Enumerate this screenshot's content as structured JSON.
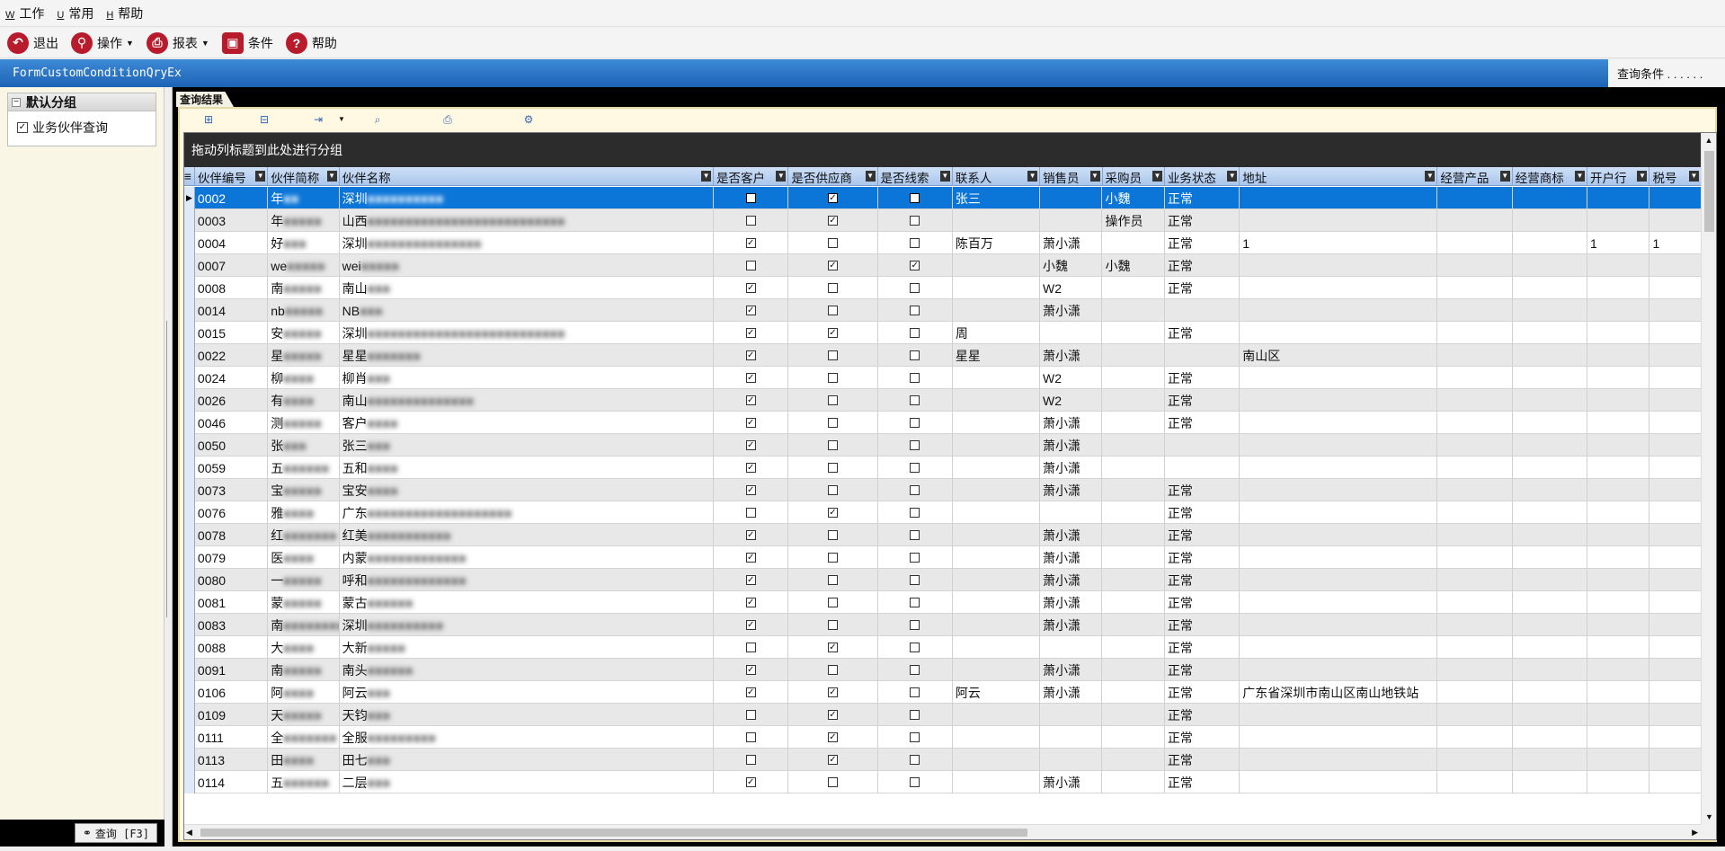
{
  "menu": [
    {
      "key": "W",
      "label": "工作"
    },
    {
      "key": "U",
      "label": "常用"
    },
    {
      "key": "H",
      "label": "帮助"
    }
  ],
  "toolbar": {
    "exit": "退出",
    "operate": "操作",
    "report": "报表",
    "condition": "条件",
    "help": "帮助"
  },
  "form": {
    "title": "FormCustomConditionQryEx",
    "right_label": "查询条件 . . . . . ."
  },
  "left": {
    "group_title": "默认分组",
    "item_label": "业务伙伴查询",
    "item_checked": true,
    "query_button": "查询 [F3]"
  },
  "tab": {
    "label": "查询结果"
  },
  "grid": {
    "group_hint": "拖动列标题到此处进行分组",
    "columns": [
      "伙伴编号",
      "伙伴简称",
      "伙伴名称",
      "是否客户",
      "是否供应商",
      "是否线索",
      "联系人",
      "销售员",
      "采购员",
      "业务状态",
      "地址",
      "经营产品",
      "经营商标",
      "开户行",
      "税号"
    ],
    "rows": [
      {
        "code": "0002",
        "short": "年**",
        "name": "深圳**********",
        "cust": false,
        "supp": true,
        "lead": false,
        "contact": "张三",
        "sales": "",
        "buyer": "小魏",
        "status": "正常",
        "addr": "",
        "bank": "",
        "tax": ""
      },
      {
        "code": "0003",
        "short": "年*****",
        "name": "山西**************************",
        "cust": false,
        "supp": true,
        "lead": false,
        "contact": "",
        "sales": "",
        "buyer": "操作员",
        "status": "正常",
        "addr": "",
        "bank": "",
        "tax": ""
      },
      {
        "code": "0004",
        "short": "好***",
        "name": "深圳***************",
        "cust": true,
        "supp": false,
        "lead": false,
        "contact": "陈百万",
        "sales": "萧小潇",
        "buyer": "",
        "status": "正常",
        "addr": "1",
        "bank": "1",
        "tax": "1"
      },
      {
        "code": "0007",
        "short": "we*****",
        "name": "wei*****",
        "cust": false,
        "supp": true,
        "lead": true,
        "contact": "",
        "sales": "小魏",
        "buyer": "小魏",
        "status": "正常",
        "addr": "",
        "bank": "",
        "tax": ""
      },
      {
        "code": "0008",
        "short": "南*****",
        "name": "南山***",
        "cust": true,
        "supp": false,
        "lead": false,
        "contact": "",
        "sales": "W2",
        "buyer": "",
        "status": "正常",
        "addr": "",
        "bank": "",
        "tax": ""
      },
      {
        "code": "0014",
        "short": "nb*****",
        "name": "NB***",
        "cust": true,
        "supp": false,
        "lead": false,
        "contact": "",
        "sales": "萧小潇",
        "buyer": "",
        "status": "",
        "addr": "",
        "bank": "",
        "tax": ""
      },
      {
        "code": "0015",
        "short": "安*****",
        "name": "深圳***************************",
        "cust": true,
        "supp": true,
        "lead": false,
        "contact": "周",
        "sales": "",
        "buyer": "",
        "status": "正常",
        "addr": "",
        "bank": "",
        "tax": ""
      },
      {
        "code": "0022",
        "short": "星*****",
        "name": "星星*******",
        "cust": true,
        "supp": false,
        "lead": false,
        "contact": "星星",
        "sales": "萧小潇",
        "buyer": "",
        "status": "",
        "addr": "南山区",
        "bank": "",
        "tax": ""
      },
      {
        "code": "0024",
        "short": "柳****",
        "name": "柳肖***",
        "cust": true,
        "supp": false,
        "lead": false,
        "contact": "",
        "sales": "W2",
        "buyer": "",
        "status": "正常",
        "addr": "",
        "bank": "",
        "tax": ""
      },
      {
        "code": "0026",
        "short": "有****",
        "name": "南山**************",
        "cust": true,
        "supp": false,
        "lead": false,
        "contact": "",
        "sales": "W2",
        "buyer": "",
        "status": "正常",
        "addr": "",
        "bank": "",
        "tax": ""
      },
      {
        "code": "0046",
        "short": "测*****",
        "name": "客户****",
        "cust": true,
        "supp": false,
        "lead": false,
        "contact": "",
        "sales": "萧小潇",
        "buyer": "",
        "status": "正常",
        "addr": "",
        "bank": "",
        "tax": ""
      },
      {
        "code": "0050",
        "short": "张***",
        "name": "张三***",
        "cust": true,
        "supp": false,
        "lead": false,
        "contact": "",
        "sales": "萧小潇",
        "buyer": "",
        "status": "",
        "addr": "",
        "bank": "",
        "tax": ""
      },
      {
        "code": "0059",
        "short": "五******",
        "name": "五和****",
        "cust": true,
        "supp": false,
        "lead": false,
        "contact": "",
        "sales": "萧小潇",
        "buyer": "",
        "status": "",
        "addr": "",
        "bank": "",
        "tax": ""
      },
      {
        "code": "0073",
        "short": "宝*****",
        "name": "宝安****",
        "cust": true,
        "supp": false,
        "lead": false,
        "contact": "",
        "sales": "萧小潇",
        "buyer": "",
        "status": "正常",
        "addr": "",
        "bank": "",
        "tax": ""
      },
      {
        "code": "0076",
        "short": "雅****",
        "name": "广东*******************",
        "cust": false,
        "supp": true,
        "lead": false,
        "contact": "",
        "sales": "",
        "buyer": "",
        "status": "正常",
        "addr": "",
        "bank": "",
        "tax": ""
      },
      {
        "code": "0078",
        "short": "红*******",
        "name": "红美***********",
        "cust": true,
        "supp": false,
        "lead": false,
        "contact": "",
        "sales": "萧小潇",
        "buyer": "",
        "status": "正常",
        "addr": "",
        "bank": "",
        "tax": ""
      },
      {
        "code": "0079",
        "short": "医****",
        "name": "内蒙*************",
        "cust": true,
        "supp": false,
        "lead": false,
        "contact": "",
        "sales": "萧小潇",
        "buyer": "",
        "status": "正常",
        "addr": "",
        "bank": "",
        "tax": ""
      },
      {
        "code": "0080",
        "short": "一*****",
        "name": "呼和*************",
        "cust": true,
        "supp": false,
        "lead": false,
        "contact": "",
        "sales": "萧小潇",
        "buyer": "",
        "status": "正常",
        "addr": "",
        "bank": "",
        "tax": ""
      },
      {
        "code": "0081",
        "short": "蒙*****",
        "name": "蒙古******",
        "cust": true,
        "supp": false,
        "lead": false,
        "contact": "",
        "sales": "萧小潇",
        "buyer": "",
        "status": "正常",
        "addr": "",
        "bank": "",
        "tax": ""
      },
      {
        "code": "0083",
        "short": "南********",
        "name": "深圳**********",
        "cust": true,
        "supp": false,
        "lead": false,
        "contact": "",
        "sales": "萧小潇",
        "buyer": "",
        "status": "正常",
        "addr": "",
        "bank": "",
        "tax": ""
      },
      {
        "code": "0088",
        "short": "大****",
        "name": "大新*****",
        "cust": false,
        "supp": true,
        "lead": false,
        "contact": "",
        "sales": "",
        "buyer": "",
        "status": "正常",
        "addr": "",
        "bank": "",
        "tax": ""
      },
      {
        "code": "0091",
        "short": "南*****",
        "name": "南头******",
        "cust": true,
        "supp": false,
        "lead": false,
        "contact": "",
        "sales": "萧小潇",
        "buyer": "",
        "status": "正常",
        "addr": "",
        "bank": "",
        "tax": ""
      },
      {
        "code": "0106",
        "short": "阿****",
        "name": "阿云***",
        "cust": true,
        "supp": true,
        "lead": false,
        "contact": "阿云",
        "sales": "萧小潇",
        "buyer": "",
        "status": "正常",
        "addr": "广东省深圳市南山区南山地铁站",
        "bank": "",
        "tax": ""
      },
      {
        "code": "0109",
        "short": "天*****",
        "name": "天钧***",
        "cust": false,
        "supp": true,
        "lead": false,
        "contact": "",
        "sales": "",
        "buyer": "",
        "status": "正常",
        "addr": "",
        "bank": "",
        "tax": ""
      },
      {
        "code": "0111",
        "short": "全*******",
        "name": "全服*********",
        "cust": false,
        "supp": true,
        "lead": false,
        "contact": "",
        "sales": "",
        "buyer": "",
        "status": "正常",
        "addr": "",
        "bank": "",
        "tax": ""
      },
      {
        "code": "0113",
        "short": "田****",
        "name": "田七***",
        "cust": false,
        "supp": true,
        "lead": false,
        "contact": "",
        "sales": "",
        "buyer": "",
        "status": "正常",
        "addr": "",
        "bank": "",
        "tax": ""
      },
      {
        "code": "0114",
        "short": "五******",
        "name": "二层***",
        "cust": true,
        "supp": false,
        "lead": false,
        "contact": "",
        "sales": "萧小潇",
        "buyer": "",
        "status": "正常",
        "addr": "",
        "bank": "",
        "tax": ""
      }
    ]
  },
  "icons": {
    "exit": "undo-circle-icon",
    "operate": "magnifier-icon",
    "report": "printer-icon",
    "condition": "condition-icon",
    "help": "question-icon"
  },
  "colors": {
    "accent": "#1e63b5",
    "selection": "#0b75d8",
    "brand_red": "#b81c2c"
  }
}
